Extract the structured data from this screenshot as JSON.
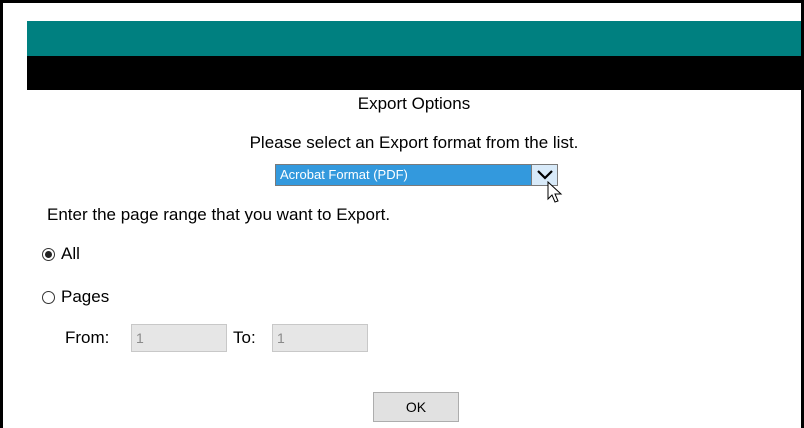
{
  "dialog": {
    "title": "Export Options",
    "instruction": "Please select an Export format from the list.",
    "format_select": {
      "selected": "Acrobat Format (PDF)"
    },
    "range_label": "Enter the page range that you want to Export.",
    "radio_all": "All",
    "radio_pages": "Pages",
    "selected_range": "All",
    "from_label": "From:",
    "from_value": "1",
    "to_label": "To:",
    "to_value": "1",
    "ok_label": "OK"
  },
  "colors": {
    "header_bar": "#008080",
    "sub_bar": "#000000",
    "select_highlight": "#3399dd"
  },
  "icons": {
    "dropdown": "chevron-down-icon",
    "cursor": "mouse-pointer-icon"
  }
}
